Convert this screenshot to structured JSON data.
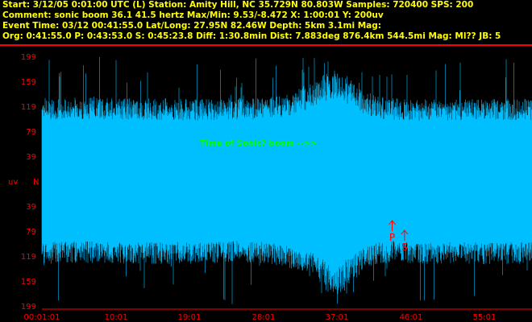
{
  "header": {
    "line1": "Start:  3/12/05  0:01:00 UTC (L) Station: Amity Hill, NC  35.729N 80.803W Samples: 720400  SPS: 200",
    "line2": "Comment:  sonic boom 36.1 41.5 hertz  Max/Min:  9.53/-8.472 X:  1:00:01 Y:  200uv",
    "line3": "Event Time: 03/12 00:41:55.0 Lat/Long: 27.95N 82.46W Depth:  5km  3.1mi Mag:",
    "line4": "Org:  0:41:55.0 P:  0:43:53.0 S:  0:45:23.8 Diff:  1:30.8min Dist:  7.883deg 876.4km 544.5mi   Mag: Ml??  JB:  5"
  },
  "colors": {
    "background": "#000000",
    "header_text": "#ffff00",
    "waveform": "#00bfff",
    "axis_labels": "#ff0000",
    "annotation": "#00ff00",
    "phase_markers": "#ff0000",
    "separator": "#ff0000"
  },
  "chart_data": {
    "type": "line",
    "y_ticks": [
      "199",
      "159",
      "119",
      "79",
      "39",
      "N",
      "39",
      "79",
      "119",
      "159",
      "199"
    ],
    "y_unit": "uv",
    "x_ticks": [
      "00:01:01",
      "10:01",
      "19:01",
      "28:01",
      "37:01",
      "46:01",
      "55:01"
    ],
    "annotation": "Time of Sonic? boom -->>",
    "phases": [
      {
        "label": "P",
        "time": "0:43:53.0"
      },
      {
        "label": "S",
        "time": "0:45:23.8"
      }
    ],
    "envelope": {
      "x_minutes": [
        1,
        5,
        10,
        15,
        20,
        25,
        28,
        31,
        34,
        36,
        37,
        38,
        40,
        42,
        44,
        46,
        50,
        55,
        61
      ],
      "upper": [
        125,
        127,
        126,
        125,
        124,
        126,
        126,
        130,
        150,
        165,
        170,
        160,
        140,
        128,
        125,
        124,
        123,
        124,
        125
      ],
      "lower": [
        -125,
        -123,
        -124,
        -125,
        -124,
        -122,
        -124,
        -130,
        -145,
        -165,
        -175,
        -162,
        -140,
        -126,
        -122,
        -125,
        -124,
        -125,
        -124
      ],
      "spike_max": 199
    }
  }
}
